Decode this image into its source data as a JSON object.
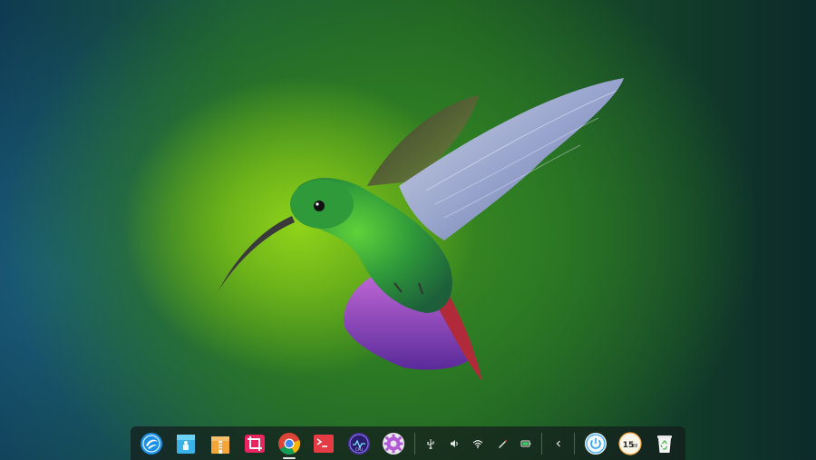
{
  "desktop": {
    "wallpaper": "hummingbird",
    "colors": {
      "dock_bg": "#141c1c",
      "accent": "#2ca7f8"
    }
  },
  "dock": {
    "apps": [
      {
        "name": "launcher",
        "icon": "deepin-logo-icon"
      },
      {
        "name": "app-store",
        "icon": "app-store-icon"
      },
      {
        "name": "archive-manager",
        "icon": "archive-icon"
      },
      {
        "name": "screenshot",
        "icon": "crop-icon"
      },
      {
        "name": "chrome",
        "icon": "chrome-icon",
        "active": true
      },
      {
        "name": "terminal",
        "icon": "terminal-icon"
      },
      {
        "name": "system-monitor",
        "icon": "cpu-monitor-icon",
        "label": "CPU"
      },
      {
        "name": "settings",
        "icon": "gear-icon"
      }
    ],
    "tray": [
      {
        "name": "usb",
        "icon": "usb-icon"
      },
      {
        "name": "volume",
        "icon": "volume-icon"
      },
      {
        "name": "wifi",
        "icon": "wifi-icon"
      },
      {
        "name": "edit",
        "icon": "pen-icon"
      },
      {
        "name": "battery",
        "icon": "battery-icon"
      },
      {
        "name": "expand",
        "icon": "chevron-left-icon"
      }
    ],
    "right": [
      {
        "name": "power",
        "icon": "power-icon"
      },
      {
        "name": "clock",
        "icon": "clock-icon",
        "hours": "15",
        "minutes": "28"
      },
      {
        "name": "trash",
        "icon": "trash-icon"
      }
    ]
  }
}
